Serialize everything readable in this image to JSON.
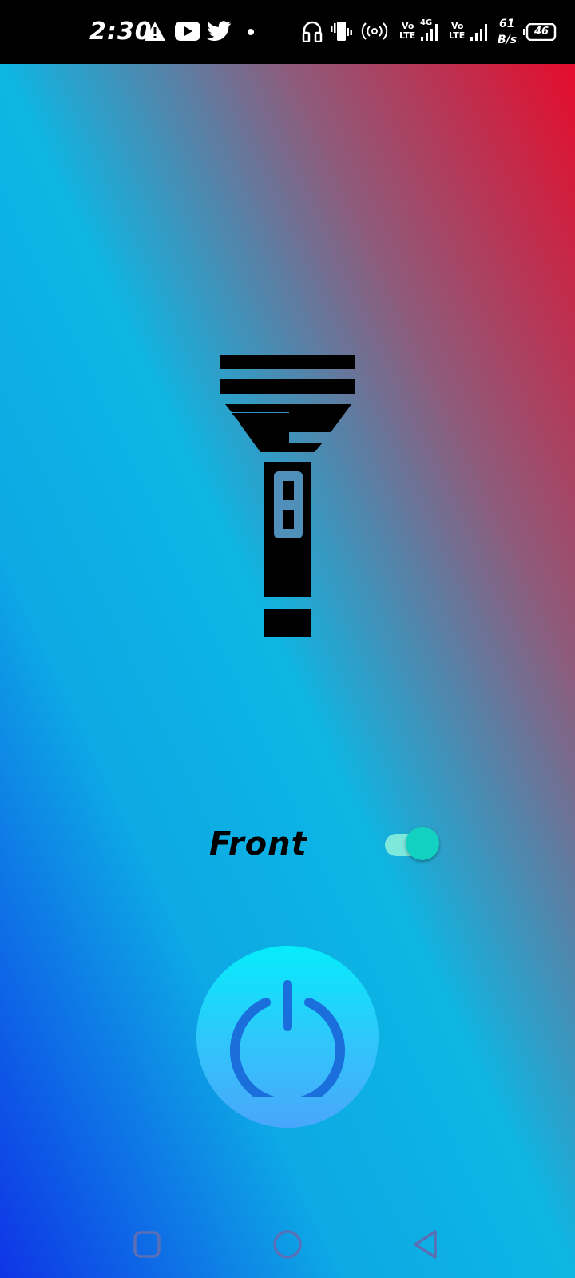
{
  "status_bar": {
    "time": "2:30",
    "network_speed_value": "61",
    "network_speed_unit": "B/s",
    "battery_level": "46",
    "volte_1": "Vo",
    "lte_1": "LTE",
    "network_type": "4G",
    "volte_2": "Vo",
    "lte_2": "LTE",
    "icons": [
      "warning-icon",
      "youtube-icon",
      "twitter-icon",
      "dot-icon",
      "headphones-icon",
      "vibrate-icon",
      "hotspot-icon",
      "signal-icon",
      "signal-icon",
      "battery-icon"
    ]
  },
  "flashlight": {
    "icon": "flashlight-icon"
  },
  "camera_toggle": {
    "label": "Front",
    "enabled": true,
    "accent_color": "#13d1c0"
  },
  "power_button": {
    "icon": "power-icon",
    "color": "#2ec8fb"
  },
  "nav_bar": {
    "buttons": [
      "recents-icon",
      "home-icon",
      "back-icon"
    ]
  }
}
